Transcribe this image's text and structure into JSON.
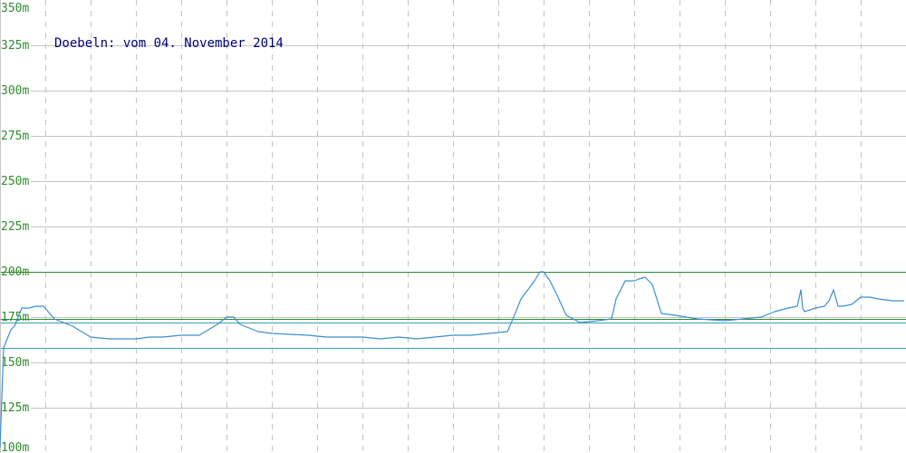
{
  "chart_data": {
    "type": "line",
    "title": "Doebeln: vom 04. November 2014",
    "xlabel": "",
    "ylabel": "",
    "ylim": [
      100,
      350
    ],
    "y_unit": "m",
    "y_ticks": [
      350,
      325,
      300,
      275,
      250,
      225,
      200,
      175,
      150,
      125,
      100
    ],
    "y_tick_labels": [
      "350m",
      "325m",
      "300m",
      "275m",
      "250m",
      "225m",
      "200m",
      "175m",
      "150m",
      "125m",
      "100m"
    ],
    "x_range": [
      0,
      1
    ],
    "x_grid_divisions": 20,
    "grid": true,
    "reference_lines": [
      {
        "value": 200,
        "color": "#2e8b2e"
      },
      {
        "value": 174,
        "color": "#2e8b2e"
      },
      {
        "value": 172,
        "color": "#3aa0b0"
      },
      {
        "value": 158,
        "color": "#3aa0b0"
      }
    ],
    "series": [
      {
        "color": "#3b8fd1",
        "x": [
          0.0,
          0.004,
          0.008,
          0.012,
          0.016,
          0.024,
          0.032,
          0.04,
          0.048,
          0.06,
          0.08,
          0.1,
          0.12,
          0.15,
          0.165,
          0.18,
          0.2,
          0.22,
          0.24,
          0.25,
          0.258,
          0.265,
          0.27,
          0.285,
          0.3,
          0.34,
          0.36,
          0.38,
          0.4,
          0.42,
          0.44,
          0.46,
          0.48,
          0.5,
          0.52,
          0.54,
          0.56,
          0.567,
          0.575,
          0.59,
          0.596,
          0.6,
          0.607,
          0.615,
          0.625,
          0.64,
          0.66,
          0.675,
          0.68,
          0.69,
          0.7,
          0.705,
          0.712,
          0.72,
          0.73,
          0.745,
          0.77,
          0.8,
          0.82,
          0.84,
          0.85,
          0.855,
          0.87,
          0.88,
          0.884,
          0.886,
          0.888,
          0.9,
          0.91,
          0.915,
          0.92,
          0.925,
          0.93,
          0.94,
          0.95,
          0.96,
          0.97,
          0.985,
          0.998
        ],
        "y": [
          103,
          158,
          163,
          168,
          170,
          180,
          180,
          181,
          181,
          174,
          170,
          164,
          163,
          163,
          164,
          164,
          165,
          165,
          171,
          175,
          175,
          171,
          170,
          167,
          166,
          165,
          164,
          164,
          164,
          163,
          164,
          163,
          164,
          165,
          165,
          166,
          167,
          175,
          185,
          195,
          200,
          200,
          195,
          187,
          176,
          172,
          173,
          174,
          185,
          195,
          195,
          196,
          197,
          193,
          177,
          176,
          174,
          173,
          174,
          175,
          177,
          178,
          180,
          181,
          190,
          180,
          178,
          180,
          181,
          184,
          190,
          181,
          181,
          182,
          186,
          186,
          185,
          184,
          184
        ]
      }
    ]
  }
}
